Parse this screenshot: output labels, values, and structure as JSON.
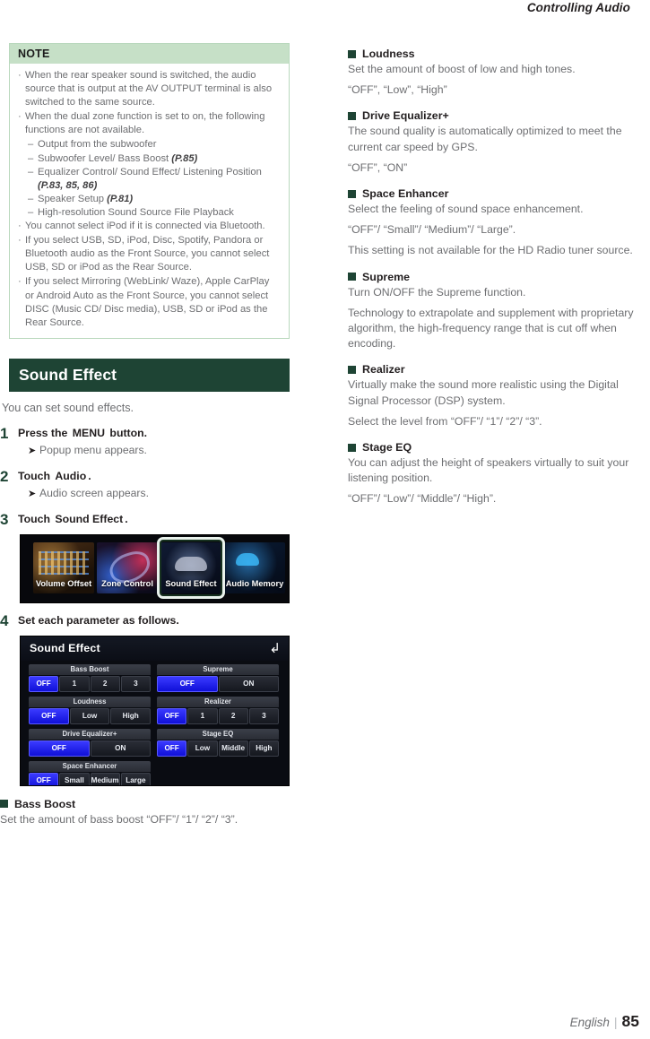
{
  "header": {
    "running_title": "Controlling Audio"
  },
  "note": {
    "title": "NOTE",
    "items": [
      {
        "text": "When the rear speaker sound is switched, the audio source that is output at the AV OUTPUT terminal is also switched to the same source.",
        "subs": []
      },
      {
        "text": "When the dual zone function is set to on, the following functions are not available.",
        "subs": [
          {
            "text": "Output from the subwoofer",
            "ref": ""
          },
          {
            "text": "Subwoofer Level/ Bass Boost ",
            "ref": "(P.85)"
          },
          {
            "text": "Equalizer Control/ Sound Effect/ Listening Position ",
            "ref": "(P.83, 85, 86)"
          },
          {
            "text": "Speaker Setup ",
            "ref": "(P.81)"
          },
          {
            "text": "High-resolution Sound Source File Playback",
            "ref": ""
          }
        ]
      },
      {
        "text": "You cannot select iPod if it is connected via Bluetooth.",
        "subs": []
      },
      {
        "text": "If you select USB, SD, iPod, Disc, Spotify, Pandora or Bluetooth audio as the Front Source, you cannot select USB, SD or iPod as the Rear Source.",
        "subs": []
      },
      {
        "text": "If you select Mirroring (WebLink/ Waze), Apple CarPlay or Android Auto as the Front Source, you cannot select DISC (Music CD/ Disc media), USB, SD or iPod as the Rear Source.",
        "subs": []
      }
    ]
  },
  "section": {
    "banner_title": "Sound Effect",
    "intro": "You can set sound effects.",
    "steps": [
      {
        "num": "1",
        "pre": "Press the ",
        "key": "MENU",
        "post": " button.",
        "sub": "Popup menu appears."
      },
      {
        "num": "2",
        "pre": "Touch ",
        "key": "Audio",
        "post": ".",
        "sub": "Audio screen appears."
      },
      {
        "num": "3",
        "pre": "Touch ",
        "key": "Sound Effect",
        "post": ".",
        "sub": ""
      },
      {
        "num": "4",
        "pre": "Set each parameter as follows.",
        "key": "",
        "post": "",
        "sub": ""
      }
    ]
  },
  "tiles_screenshot": {
    "tiles": [
      {
        "label": "Volume Offset",
        "art": "art-volume",
        "selected": false
      },
      {
        "label": "Zone Control",
        "art": "art-zone",
        "selected": false
      },
      {
        "label": "Sound Effect",
        "art": "art-sound",
        "selected": true
      },
      {
        "label": "Audio Memory",
        "art": "art-memory",
        "selected": false
      }
    ]
  },
  "sound_effect_screen": {
    "title": "Sound Effect",
    "back_icon": "back-arrow-icon",
    "accent_color": "#2424ff",
    "left_groups": [
      {
        "label": "Bass Boost",
        "options": [
          "OFF",
          "1",
          "2",
          "3"
        ],
        "selected": 0
      },
      {
        "label": "Loudness",
        "options": [
          "OFF",
          "Low",
          "High"
        ],
        "selected": 0
      },
      {
        "label": "Drive Equalizer+",
        "options": [
          "OFF",
          "ON"
        ],
        "selected": 0
      },
      {
        "label": "Space Enhancer",
        "options": [
          "OFF",
          "Small",
          "Medium",
          "Large"
        ],
        "selected": 0
      }
    ],
    "right_groups": [
      {
        "label": "Supreme",
        "options": [
          "OFF",
          "ON"
        ],
        "selected": 0
      },
      {
        "label": "Realizer",
        "options": [
          "OFF",
          "1",
          "2",
          "3"
        ],
        "selected": 0
      },
      {
        "label": "Stage EQ",
        "options": [
          "OFF",
          "Low",
          "Middle",
          "High"
        ],
        "selected": 0
      }
    ]
  },
  "definitions_left": [
    {
      "heading": "Bass Boost",
      "paragraphs": [
        "Set the amount of bass boost “OFF”/ “1”/ “2”/ “3”."
      ]
    }
  ],
  "definitions_right": [
    {
      "heading": "Loudness",
      "paragraphs": [
        "Set the amount of boost of low and high tones.",
        "“OFF”, “Low”, “High”"
      ]
    },
    {
      "heading": "Drive Equalizer+",
      "paragraphs": [
        "The sound quality is automatically optimized to meet the current car speed by GPS.",
        "“OFF”, “ON”"
      ]
    },
    {
      "heading": "Space Enhancer",
      "paragraphs": [
        "Select the feeling of sound space enhancement.",
        "“OFF”/ “Small”/ “Medium”/ “Large”.",
        "This setting is not available for the HD Radio tuner source."
      ]
    },
    {
      "heading": "Supreme",
      "paragraphs": [
        "Turn ON/OFF the Supreme function.",
        "Technology to extrapolate and supplement with proprietary algorithm, the high-frequency range that is cut off when encoding."
      ]
    },
    {
      "heading": "Realizer",
      "paragraphs": [
        "Virtually make the sound more realistic using the Digital Signal Processor (DSP) system.",
        "Select the level from “OFF”/ “1”/ “2”/ “3”."
      ]
    },
    {
      "heading": "Stage EQ",
      "paragraphs": [
        "You can adjust the height of speakers virtually to suit your listening position.",
        "“OFF”/ “Low”/ “Middle”/ “High”."
      ]
    }
  ],
  "footer": {
    "language": "English",
    "separator": "|",
    "page_number": "85"
  }
}
